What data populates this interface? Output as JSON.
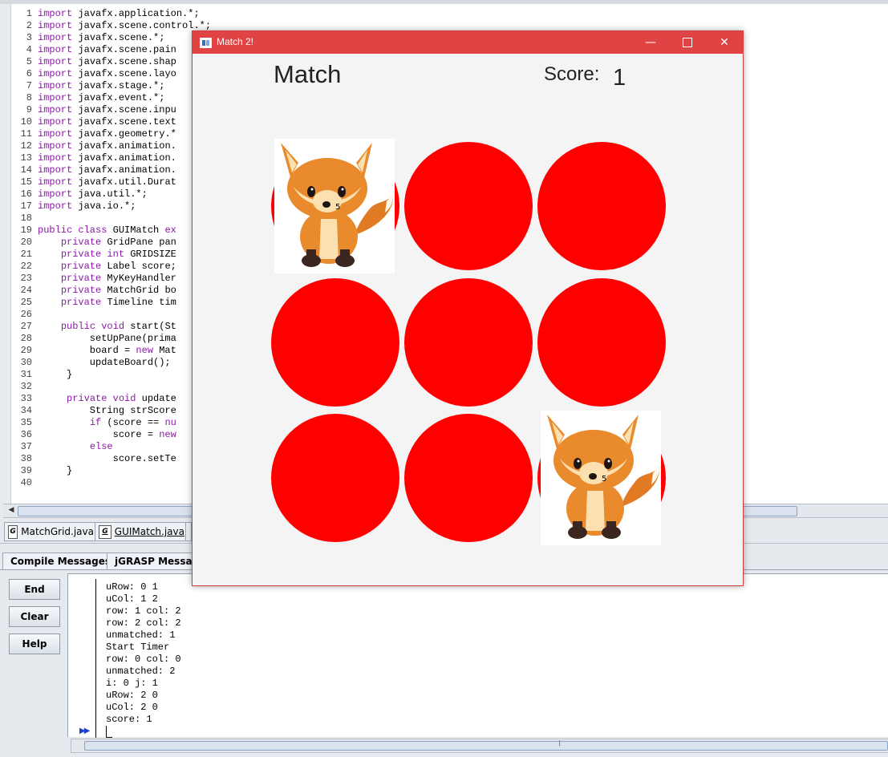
{
  "editor": {
    "lines": [
      {
        "no": "1",
        "html": "<span class=\"kw\">import</span> javafx.application.*;"
      },
      {
        "no": "2",
        "html": "<span class=\"kw\">import</span> javafx.scene.control.*;"
      },
      {
        "no": "3",
        "html": "<span class=\"kw\">import</span> javafx.scene.*;"
      },
      {
        "no": "4",
        "html": "<span class=\"kw\">import</span> javafx.scene.pain"
      },
      {
        "no": "5",
        "html": "<span class=\"kw\">import</span> javafx.scene.shap"
      },
      {
        "no": "6",
        "html": "<span class=\"kw\">import</span> javafx.scene.layo"
      },
      {
        "no": "7",
        "html": "<span class=\"kw\">import</span> javafx.stage.*;"
      },
      {
        "no": "8",
        "html": "<span class=\"kw\">import</span> javafx.event.*;"
      },
      {
        "no": "9",
        "html": "<span class=\"kw\">import</span> javafx.scene.inpu"
      },
      {
        "no": "10",
        "html": "<span class=\"kw\">import</span> javafx.scene.text"
      },
      {
        "no": "11",
        "html": "<span class=\"kw\">import</span> javafx.geometry.*"
      },
      {
        "no": "12",
        "html": "<span class=\"kw\">import</span> javafx.animation."
      },
      {
        "no": "13",
        "html": "<span class=\"kw\">import</span> javafx.animation."
      },
      {
        "no": "14",
        "html": "<span class=\"kw\">import</span> javafx.animation."
      },
      {
        "no": "15",
        "html": "<span class=\"kw\">import</span> javafx.util.Durat"
      },
      {
        "no": "16",
        "html": "<span class=\"kw\">import</span> java.util.*;"
      },
      {
        "no": "17",
        "html": "<span class=\"kw\">import</span> java.io.*;"
      },
      {
        "no": "18",
        "html": ""
      },
      {
        "no": "19",
        "html": "<span class=\"kw\">public class</span> GUIMatch <span class=\"kw\">ex</span>"
      },
      {
        "no": "20",
        "html": "    <span class=\"kw\">private</span> GridPane pan"
      },
      {
        "no": "21",
        "html": "    <span class=\"kw\">private int</span> GRIDSIZE"
      },
      {
        "no": "22",
        "html": "    <span class=\"kw\">private</span> Label score;"
      },
      {
        "no": "23",
        "html": "    <span class=\"kw\">private</span> MyKeyHandler"
      },
      {
        "no": "24",
        "html": "    <span class=\"kw\">private</span> MatchGrid bo"
      },
      {
        "no": "25",
        "html": "    <span class=\"kw\">private</span> Timeline tim"
      },
      {
        "no": "26",
        "html": ""
      },
      {
        "no": "27",
        "html": "    <span class=\"kw\">public void</span> start(St"
      },
      {
        "no": "28",
        "html": "         setUpPane(prima"
      },
      {
        "no": "29",
        "html": "         board = <span class=\"kw\">new</span> Mat"
      },
      {
        "no": "30",
        "html": "         updateBoard();"
      },
      {
        "no": "31",
        "html": "     }"
      },
      {
        "no": "32",
        "html": ""
      },
      {
        "no": "33",
        "html": "     <span class=\"kw\">private void</span> update"
      },
      {
        "no": "34",
        "html": "         String strScore"
      },
      {
        "no": "35",
        "html": "         <span class=\"kw\">if</span> (score == <span class=\"kw\">nu</span>"
      },
      {
        "no": "36",
        "html": "             score = <span class=\"kw\">new</span>"
      },
      {
        "no": "37",
        "html": "         <span class=\"kw\">else</span>"
      },
      {
        "no": "38",
        "html": "             score.setTe"
      },
      {
        "no": "39",
        "html": "     }"
      },
      {
        "no": "40",
        "html": ""
      }
    ]
  },
  "file_tabs": {
    "tab1": {
      "label": "MatchGrid.java",
      "icon": "G"
    },
    "tab2": {
      "label": "GUIMatch.java",
      "icon": "G"
    }
  },
  "message_tabs": {
    "compile": "Compile Messages",
    "jgrasp": "jGRASP Message"
  },
  "run_panel": {
    "end_label": "End",
    "clear_label": "Clear",
    "help_label": "Help",
    "prompt": "▶▶",
    "console_lines": "uRow: 0 1\nuCol: 1 2\nrow: 1 col: 2\nrow: 2 col: 2\nunmatched: 1\nStart Timer\nrow: 0 col: 0\nunmatched: 2\ni: 0 j: 1\nuRow: 2 0\nuCol: 2 0\nscore: 1"
  },
  "game_window": {
    "title": "Match 2!",
    "min_label": "—",
    "close_label": "✕",
    "heading": "Match",
    "score_label": "Score:",
    "score_value": "1",
    "card_color": "#ff0000",
    "grid": [
      [
        "fox-card",
        "hidden",
        "hidden"
      ],
      [
        "hidden",
        "hidden",
        "hidden"
      ],
      [
        "hidden",
        "hidden",
        "fox-card"
      ]
    ],
    "fox_badge": "5"
  }
}
